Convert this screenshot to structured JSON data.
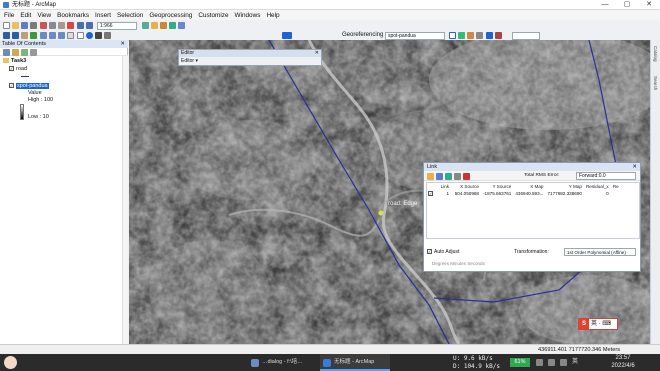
{
  "window": {
    "title": "无标题 - ArcMap"
  },
  "menu": [
    "File",
    "Edit",
    "View",
    "Bookmarks",
    "Insert",
    "Selection",
    "Geoprocessing",
    "Customize",
    "Windows",
    "Help"
  ],
  "toolbar": {
    "scale": "1:966",
    "georef_label": "Georeferencing ▾",
    "georef_layer": "spot-pandua"
  },
  "toc": {
    "title": "Table Of Contents",
    "root": "Task3",
    "layers": [
      {
        "name": "road",
        "checked": true
      },
      {
        "name": "spot-pandua",
        "checked": true
      }
    ],
    "legend": {
      "value_label": "Value",
      "high": "High : 100",
      "low": "Low : 10"
    }
  },
  "editor": {
    "title": "Editor",
    "menu_label": "Editor ▾"
  },
  "map": {
    "snap_label": "road: Edge"
  },
  "link_window": {
    "title": "Link",
    "rms_label": "Total RMS Error:",
    "transform_method": "Forward:0.0",
    "columns": [
      "Link",
      "X Source",
      "Y Source",
      "X Map",
      "Y Map",
      "Residual_x",
      "Re"
    ],
    "rows": [
      {
        "checked": true,
        "link": "1",
        "x_source": "504.050968",
        "y_source": "-1875.663761",
        "x_map": "436940.593...",
        "y_map": "7177682.338690",
        "residual_x": "0"
      }
    ],
    "auto_adjust": "Auto Adjust",
    "transformation_label": "Transformation:",
    "transformation_value": "1st Order Polynomial (Affine)",
    "degrees": "Degrees Minutes Seconds"
  },
  "status": {
    "coords": "436911.401  7177720.346 Meters"
  },
  "taskbar": {
    "tasks": [
      "…dialog - f:\\培…",
      "无标题 - ArcMap"
    ],
    "net_up": "U:   9.6 kB/s",
    "net_down": "D: 104.9 kB/s",
    "battery": "61%",
    "time": "23:57",
    "date": "2022/4/6"
  },
  "colors": {
    "road_line": "#2a2f9a",
    "selection_accent": "#1e63d6"
  }
}
